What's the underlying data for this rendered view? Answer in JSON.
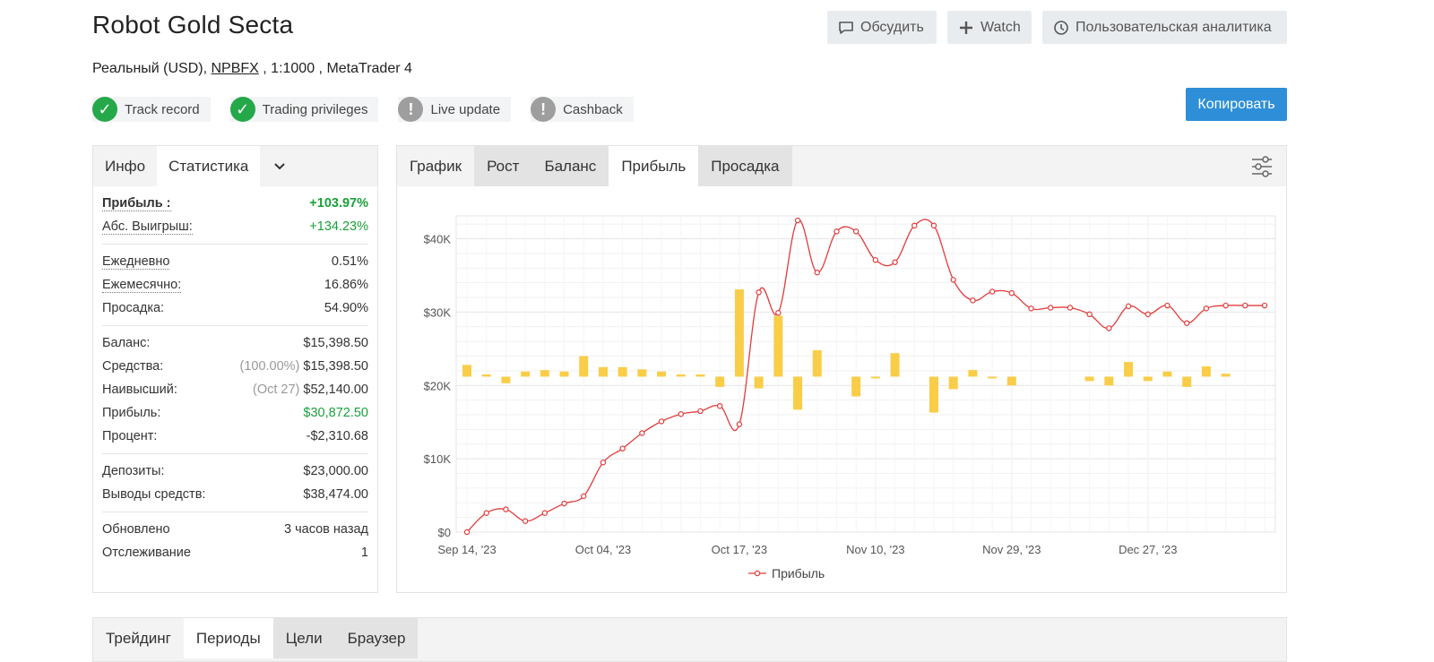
{
  "header": {
    "title": "Robot Gold Secta",
    "subtitle_prefix": "Реальный (USD), ",
    "broker": "NPBFX",
    "subtitle_suffix": " , 1:1000 , MetaTrader 4",
    "buttons": {
      "discuss": "Обсудить",
      "watch": "Watch",
      "analytics": "Пользовательская аналитика"
    },
    "copy_label": "Копировать",
    "badges": [
      {
        "label": "Track record",
        "status": "ok"
      },
      {
        "label": "Trading privileges",
        "status": "ok"
      },
      {
        "label": "Live update",
        "status": "warn"
      },
      {
        "label": "Cashback",
        "status": "warn"
      }
    ]
  },
  "stats_panel": {
    "tabs": [
      "Инфо",
      "Статистика"
    ],
    "active_tab": "Статистика",
    "groups": [
      [
        {
          "label": "Прибыль :",
          "value": "+103.97%",
          "label_style": "bold dotted",
          "value_style": "green bold"
        },
        {
          "label": "Абс. Выигрыш:",
          "value": "+134.23%",
          "label_style": "dotted",
          "value_style": "green"
        }
      ],
      [
        {
          "label": "Ежедневно",
          "value": "0.51%",
          "label_style": "dotted",
          "value_style": ""
        },
        {
          "label": "Ежемесячно:",
          "value": "16.86%",
          "label_style": "dotted",
          "value_style": ""
        },
        {
          "label": "Просадка:",
          "value": "54.90%",
          "label_style": "",
          "value_style": ""
        }
      ],
      [
        {
          "label": "Баланс:",
          "value": "$15,398.50",
          "label_style": "",
          "value_style": ""
        },
        {
          "label": "Средства:",
          "prefix": "(100.00%)",
          "value": "$15,398.50",
          "label_style": "",
          "value_style": ""
        },
        {
          "label": "Наивысший:",
          "prefix": "(Oct 27)",
          "value": "$52,140.00",
          "label_style": "",
          "value_style": ""
        },
        {
          "label": "Прибыль:",
          "value": "$30,872.50",
          "label_style": "",
          "value_style": "green"
        },
        {
          "label": "Процент:",
          "value": "-$2,310.68",
          "label_style": "",
          "value_style": ""
        }
      ],
      [
        {
          "label": "Депозиты:",
          "value": "$23,000.00",
          "label_style": "",
          "value_style": ""
        },
        {
          "label": "Выводы средств:",
          "value": "$38,474.00",
          "label_style": "",
          "value_style": ""
        }
      ],
      [
        {
          "label": "Обновлено",
          "value": "3 часов назад",
          "label_style": "",
          "value_style": ""
        },
        {
          "label": "Отслеживание",
          "value": "1",
          "label_style": "",
          "value_style": ""
        }
      ]
    ]
  },
  "chart_panel": {
    "tabs": [
      "График",
      "Рост",
      "Баланс",
      "Прибыль",
      "Просадка"
    ],
    "active_tab": "Прибыль"
  },
  "chart_data": {
    "type": "line",
    "legend": "Прибыль",
    "legend_position": "bottom-center",
    "line_color": "#e23b3b",
    "bar_color": "#f9cd48",
    "grid": true,
    "ylim": [
      0,
      43000
    ],
    "yticks": [
      0,
      10000,
      20000,
      30000,
      40000
    ],
    "ytick_labels": [
      "$0",
      "$10K",
      "$20K",
      "$30K",
      "$40K"
    ],
    "xtick_labels": [
      "Sep 14, '23",
      "Oct 04, '23",
      "Oct 17, '23",
      "Nov 10, '23",
      "Nov 29, '23",
      "Dec 27, '23"
    ],
    "n_points": 42,
    "xtick_indices": [
      0,
      7,
      14,
      21,
      28,
      35
    ],
    "series": [
      {
        "values": [
          0,
          2600,
          3100,
          1500,
          2600,
          3900,
          4900,
          9500,
          11400,
          13500,
          15100,
          16100,
          16500,
          17200,
          14700,
          32700,
          29900,
          42500,
          35400,
          41000,
          41000,
          37100,
          36800,
          41800,
          41800,
          34400,
          31600,
          32800,
          32600,
          30500,
          30600,
          30600,
          29700,
          27800,
          30800,
          29700,
          30900,
          28500,
          30500,
          30900,
          30900,
          30900
        ]
      }
    ],
    "bars": {
      "baseline": 21200,
      "values": [
        1600,
        300,
        -900,
        700,
        900,
        700,
        2800,
        1300,
        1300,
        1000,
        700,
        300,
        300,
        -1400,
        11900,
        -1600,
        8300,
        -4500,
        3600,
        0,
        -2700,
        -200,
        3200,
        0,
        -4900,
        -1700,
        900,
        -200,
        -1200,
        0,
        0,
        0,
        -600,
        -1200,
        2000,
        -600,
        700,
        -1400,
        1400,
        400,
        0,
        0
      ]
    }
  },
  "bottom_tabs": {
    "tabs": [
      "Трейдинг",
      "Периоды",
      "Цели",
      "Браузер"
    ],
    "active_tab": "Периоды"
  }
}
